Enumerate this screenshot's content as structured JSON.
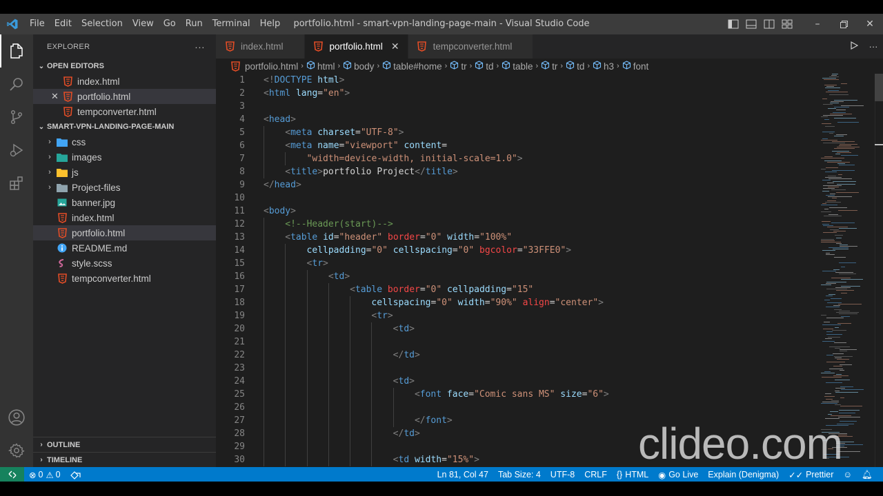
{
  "window": {
    "title": "portfolio.html - smart-vpn-landing-page-main - Visual Studio Code",
    "menu": [
      "File",
      "Edit",
      "Selection",
      "View",
      "Go",
      "Run",
      "Terminal",
      "Help"
    ]
  },
  "sidebar": {
    "header": "EXPLORER",
    "more": "···",
    "open_editors": {
      "title": "OPEN EDITORS",
      "items": [
        {
          "name": "index.html",
          "icon": "html-icon"
        },
        {
          "name": "portfolio.html",
          "icon": "html-icon",
          "selected": true,
          "close": "✕"
        },
        {
          "name": "tempconverter.html",
          "icon": "html-icon"
        }
      ]
    },
    "project": {
      "title": "SMART-VPN-LANDING-PAGE-MAIN",
      "folders": [
        {
          "name": "css",
          "icon": "css-folder-icon"
        },
        {
          "name": "images",
          "icon": "images-folder-icon"
        },
        {
          "name": "js",
          "icon": "js-folder-icon"
        },
        {
          "name": "Project-files",
          "icon": "folder-icon"
        }
      ],
      "files": [
        {
          "name": "banner.jpg",
          "icon": "image-file-icon"
        },
        {
          "name": "index.html",
          "icon": "html-icon"
        },
        {
          "name": "portfolio.html",
          "icon": "html-icon",
          "selected": true
        },
        {
          "name": "README.md",
          "icon": "info-icon"
        },
        {
          "name": "style.scss",
          "icon": "scss-icon"
        },
        {
          "name": "tempconverter.html",
          "icon": "html-icon"
        }
      ]
    },
    "outline": "OUTLINE",
    "timeline": "TIMELINE"
  },
  "tabs": [
    {
      "label": "index.html",
      "active": false
    },
    {
      "label": "portfolio.html",
      "active": true,
      "close": "✕"
    },
    {
      "label": "tempconverter.html",
      "active": false
    }
  ],
  "breadcrumb": [
    "portfolio.html",
    "html",
    "body",
    "table#home",
    "tr",
    "td",
    "table",
    "tr",
    "td",
    "h3",
    "font"
  ],
  "code": [
    {
      "n": "1",
      "indent": 0,
      "tokens": [
        [
          "br",
          "<!"
        ],
        [
          "tag",
          "DOCTYPE"
        ],
        [
          "txt",
          " "
        ],
        [
          "attr",
          "html"
        ],
        [
          "br",
          ">"
        ]
      ]
    },
    {
      "n": "2",
      "indent": 0,
      "tokens": [
        [
          "br",
          "<"
        ],
        [
          "tag",
          "html"
        ],
        [
          "txt",
          " "
        ],
        [
          "attr",
          "lang"
        ],
        [
          "txt",
          "="
        ],
        [
          "val",
          "\"en\""
        ],
        [
          "br",
          ">"
        ]
      ]
    },
    {
      "n": "3",
      "indent": 0,
      "tokens": []
    },
    {
      "n": "4",
      "indent": 0,
      "tokens": [
        [
          "br",
          "<"
        ],
        [
          "tag",
          "head"
        ],
        [
          "br",
          ">"
        ]
      ]
    },
    {
      "n": "5",
      "indent": 1,
      "tokens": [
        [
          "br",
          "<"
        ],
        [
          "tag",
          "meta"
        ],
        [
          "txt",
          " "
        ],
        [
          "attr",
          "charset"
        ],
        [
          "txt",
          "="
        ],
        [
          "val",
          "\"UTF-8\""
        ],
        [
          "br",
          ">"
        ]
      ]
    },
    {
      "n": "6",
      "indent": 1,
      "tokens": [
        [
          "br",
          "<"
        ],
        [
          "tag",
          "meta"
        ],
        [
          "txt",
          " "
        ],
        [
          "attr",
          "name"
        ],
        [
          "txt",
          "="
        ],
        [
          "val",
          "\"viewport\""
        ],
        [
          "txt",
          " "
        ],
        [
          "attr",
          "content"
        ],
        [
          "txt",
          "="
        ]
      ]
    },
    {
      "n": "7",
      "indent": 2,
      "tokens": [
        [
          "val",
          "\"width=device-width, initial-scale=1.0\""
        ],
        [
          "br",
          ">"
        ]
      ]
    },
    {
      "n": "8",
      "indent": 1,
      "tokens": [
        [
          "br",
          "<"
        ],
        [
          "tag",
          "title"
        ],
        [
          "br",
          ">"
        ],
        [
          "txt",
          "portfolio Project"
        ],
        [
          "br",
          "</"
        ],
        [
          "tag",
          "title"
        ],
        [
          "br",
          ">"
        ]
      ]
    },
    {
      "n": "9",
      "indent": 0,
      "tokens": [
        [
          "br",
          "</"
        ],
        [
          "tag",
          "head"
        ],
        [
          "br",
          ">"
        ]
      ]
    },
    {
      "n": "10",
      "indent": 0,
      "tokens": []
    },
    {
      "n": "11",
      "indent": 0,
      "tokens": [
        [
          "br",
          "<"
        ],
        [
          "tag",
          "body"
        ],
        [
          "br",
          ">"
        ]
      ]
    },
    {
      "n": "12",
      "indent": 1,
      "tokens": [
        [
          "com",
          "<!--Header(start)-->"
        ]
      ]
    },
    {
      "n": "13",
      "indent": 1,
      "tokens": [
        [
          "br",
          "<"
        ],
        [
          "tag",
          "table"
        ],
        [
          "txt",
          " "
        ],
        [
          "attr",
          "id"
        ],
        [
          "txt",
          "="
        ],
        [
          "val",
          "\"header\""
        ],
        [
          "txt",
          " "
        ],
        [
          "red",
          "border"
        ],
        [
          "txt",
          "="
        ],
        [
          "val",
          "\"0\""
        ],
        [
          "txt",
          " "
        ],
        [
          "attr",
          "width"
        ],
        [
          "txt",
          "="
        ],
        [
          "val",
          "\"100%\""
        ]
      ]
    },
    {
      "n": "14",
      "indent": 2,
      "tokens": [
        [
          "attr",
          "cellpadding"
        ],
        [
          "txt",
          "="
        ],
        [
          "val",
          "\"0\""
        ],
        [
          "txt",
          " "
        ],
        [
          "attr",
          "cellspacing"
        ],
        [
          "txt",
          "="
        ],
        [
          "val",
          "\"0\""
        ],
        [
          "txt",
          " "
        ],
        [
          "red",
          "bgcolor"
        ],
        [
          "txt",
          "="
        ],
        [
          "val",
          "\"33FFE0\""
        ],
        [
          "br",
          ">"
        ]
      ]
    },
    {
      "n": "15",
      "indent": 2,
      "tokens": [
        [
          "br",
          "<"
        ],
        [
          "tag",
          "tr"
        ],
        [
          "br",
          ">"
        ]
      ]
    },
    {
      "n": "16",
      "indent": 3,
      "tokens": [
        [
          "br",
          "<"
        ],
        [
          "tag",
          "td"
        ],
        [
          "br",
          ">"
        ]
      ]
    },
    {
      "n": "17",
      "indent": 4,
      "tokens": [
        [
          "br",
          "<"
        ],
        [
          "tag",
          "table"
        ],
        [
          "txt",
          " "
        ],
        [
          "red",
          "border"
        ],
        [
          "txt",
          "="
        ],
        [
          "val",
          "\"0\""
        ],
        [
          "txt",
          " "
        ],
        [
          "attr",
          "cellpadding"
        ],
        [
          "txt",
          "="
        ],
        [
          "val",
          "\"15\""
        ]
      ]
    },
    {
      "n": "18",
      "indent": 5,
      "tokens": [
        [
          "attr",
          "cellspacing"
        ],
        [
          "txt",
          "="
        ],
        [
          "val",
          "\"0\""
        ],
        [
          "txt",
          " "
        ],
        [
          "attr",
          "width"
        ],
        [
          "txt",
          "="
        ],
        [
          "val",
          "\"90%\""
        ],
        [
          "txt",
          " "
        ],
        [
          "red",
          "align"
        ],
        [
          "txt",
          "="
        ],
        [
          "val",
          "\"center\""
        ],
        [
          "br",
          ">"
        ]
      ]
    },
    {
      "n": "19",
      "indent": 5,
      "tokens": [
        [
          "br",
          "<"
        ],
        [
          "tag",
          "tr"
        ],
        [
          "br",
          ">"
        ]
      ]
    },
    {
      "n": "20",
      "indent": 6,
      "tokens": [
        [
          "br",
          "<"
        ],
        [
          "tag",
          "td"
        ],
        [
          "br",
          ">"
        ]
      ]
    },
    {
      "n": "21",
      "indent": 6,
      "tokens": []
    },
    {
      "n": "22",
      "indent": 6,
      "tokens": [
        [
          "br",
          "</"
        ],
        [
          "tag",
          "td"
        ],
        [
          "br",
          ">"
        ]
      ]
    },
    {
      "n": "23",
      "indent": 6,
      "tokens": []
    },
    {
      "n": "24",
      "indent": 6,
      "tokens": [
        [
          "br",
          "<"
        ],
        [
          "tag",
          "td"
        ],
        [
          "br",
          ">"
        ]
      ]
    },
    {
      "n": "25",
      "indent": 7,
      "tokens": [
        [
          "br",
          "<"
        ],
        [
          "tag",
          "font"
        ],
        [
          "txt",
          " "
        ],
        [
          "attr",
          "face"
        ],
        [
          "txt",
          "="
        ],
        [
          "val",
          "\"Comic sans MS\""
        ],
        [
          "txt",
          " "
        ],
        [
          "attr",
          "size"
        ],
        [
          "txt",
          "="
        ],
        [
          "val",
          "\"6\""
        ],
        [
          "br",
          ">"
        ]
      ]
    },
    {
      "n": "26",
      "indent": 7,
      "tokens": []
    },
    {
      "n": "27",
      "indent": 7,
      "tokens": [
        [
          "br",
          "</"
        ],
        [
          "tag",
          "font"
        ],
        [
          "br",
          ">"
        ]
      ]
    },
    {
      "n": "28",
      "indent": 6,
      "tokens": [
        [
          "br",
          "</"
        ],
        [
          "tag",
          "td"
        ],
        [
          "br",
          ">"
        ]
      ]
    },
    {
      "n": "29",
      "indent": 6,
      "tokens": []
    },
    {
      "n": "30",
      "indent": 6,
      "tokens": [
        [
          "br",
          "<"
        ],
        [
          "tag",
          "td"
        ],
        [
          "txt",
          " "
        ],
        [
          "attr",
          "width"
        ],
        [
          "txt",
          "="
        ],
        [
          "val",
          "\"15%\""
        ],
        [
          "br",
          ">"
        ]
      ]
    }
  ],
  "statusbar": {
    "errors": "0",
    "warnings": "0",
    "position": "Ln 81, Col 47",
    "tab_size": "Tab Size: 4",
    "encoding": "UTF-8",
    "eol": "CRLF",
    "language": "HTML",
    "go_live": "Go Live",
    "explain": "Explain (Denigma)",
    "prettier": "Prettier"
  },
  "watermark": "clideo.com",
  "colors": {
    "accent": "#007acc",
    "remote": "#16825d",
    "html_icon": "#e44d26",
    "css_folder": "#42a5f5",
    "js_folder": "#fbc02d",
    "images_folder": "#26a69a",
    "scss_icon": "#cd6799",
    "info_icon": "#42a5f5"
  }
}
